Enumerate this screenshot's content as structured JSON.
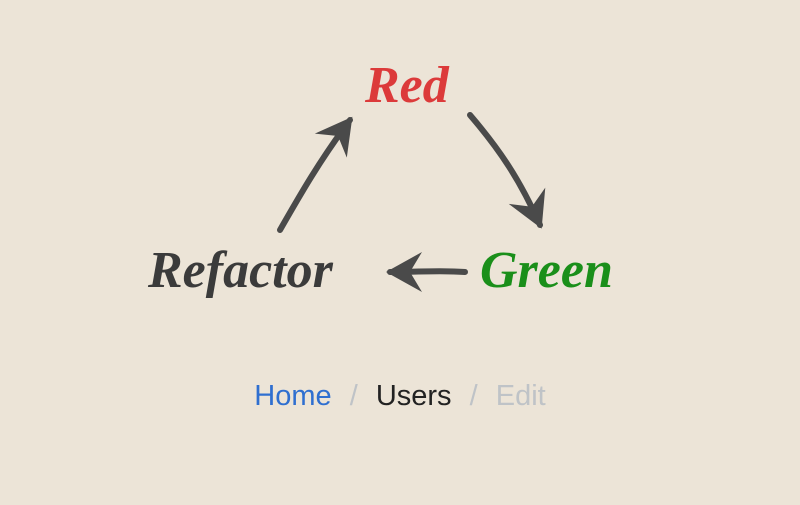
{
  "diagram": {
    "nodes": {
      "red": {
        "label": "Red",
        "color": "#dc3a3a"
      },
      "green": {
        "label": "Green",
        "color": "#1a8f1a"
      },
      "refactor": {
        "label": "Refactor",
        "color": "#3b3b3b"
      }
    },
    "edges": [
      {
        "from": "red",
        "to": "green"
      },
      {
        "from": "green",
        "to": "refactor"
      },
      {
        "from": "refactor",
        "to": "red"
      }
    ]
  },
  "breadcrumb": {
    "items": [
      {
        "label": "Home",
        "role": "link"
      },
      {
        "label": "Users",
        "role": "current"
      },
      {
        "label": "Edit",
        "role": "muted"
      }
    ],
    "separator": "/"
  }
}
